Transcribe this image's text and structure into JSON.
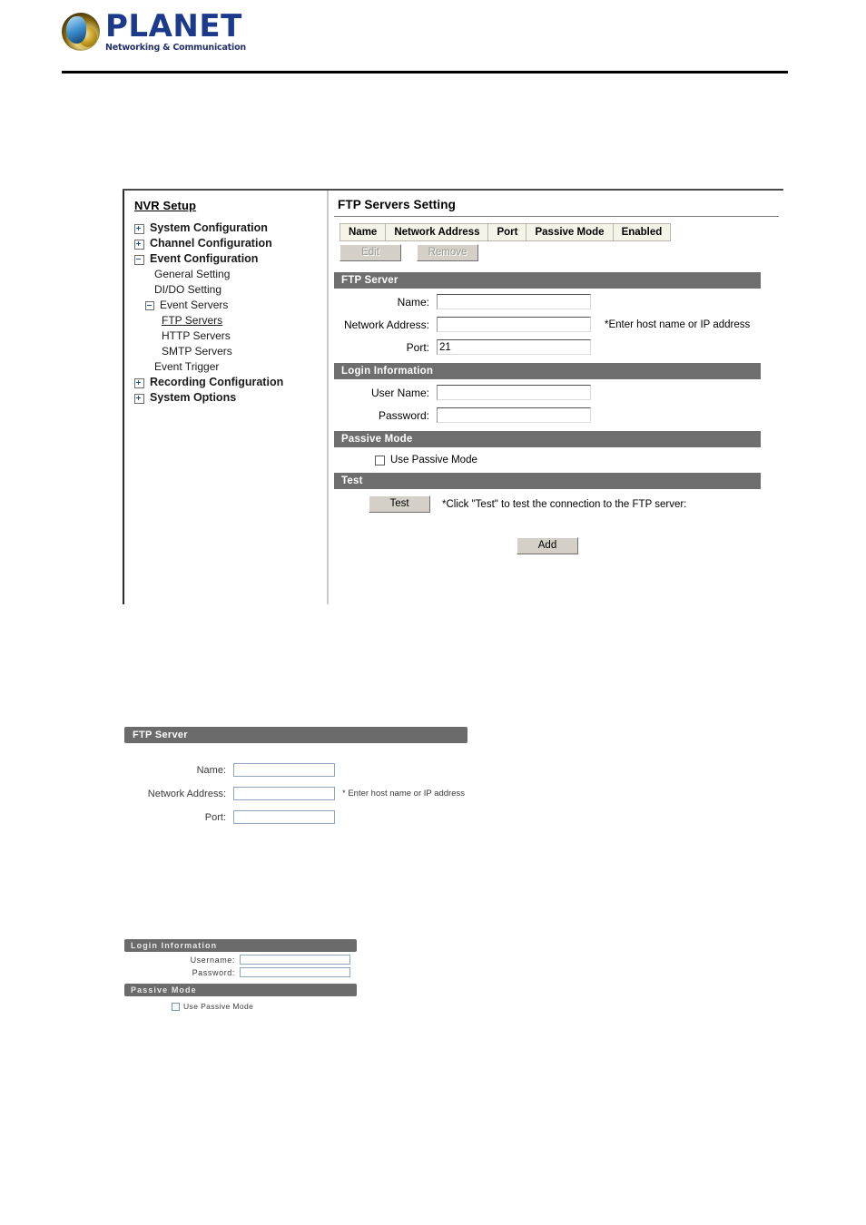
{
  "brand": {
    "name": "PLANET",
    "tagline": "Networking & Communication",
    "logo_icon": "planet-globe-icon",
    "brand_color": "#1b3a8c",
    "accent_gold": "#c9a227"
  },
  "sidebar": {
    "title": "NVR Setup",
    "items": [
      {
        "label": "System Configuration",
        "level": 0,
        "toggle": "plus",
        "current": false
      },
      {
        "label": "Channel Configuration",
        "level": 0,
        "toggle": "plus",
        "current": false
      },
      {
        "label": "Event Configuration",
        "level": 0,
        "toggle": "minus",
        "current": false
      },
      {
        "label": "General Setting",
        "level": 1,
        "toggle": "none",
        "current": false
      },
      {
        "label": "DI/DO Setting",
        "level": 1,
        "toggle": "none",
        "current": false
      },
      {
        "label": "Event Servers",
        "level": 1,
        "toggle": "minus",
        "current": false
      },
      {
        "label": "FTP Servers",
        "level": 2,
        "toggle": "none",
        "current": true
      },
      {
        "label": "HTTP Servers",
        "level": 2,
        "toggle": "none",
        "current": false
      },
      {
        "label": "SMTP Servers",
        "level": 2,
        "toggle": "none",
        "current": false
      },
      {
        "label": "Event Trigger",
        "level": 1,
        "toggle": "none",
        "current": false
      },
      {
        "label": "Recording Configuration",
        "level": 0,
        "toggle": "plus",
        "current": false
      },
      {
        "label": "System Options",
        "level": 0,
        "toggle": "plus",
        "current": false
      }
    ]
  },
  "content": {
    "title": "FTP Servers Setting",
    "table": {
      "columns": [
        "Name",
        "Network Address",
        "Port",
        "Passive Mode",
        "Enabled"
      ],
      "rows": []
    },
    "table_buttons": [
      {
        "label": "Edit",
        "disabled": true
      },
      {
        "label": "Remove",
        "disabled": true
      }
    ],
    "sections": {
      "ftp_server": {
        "header": "FTP Server",
        "fields": [
          {
            "label": "Name:",
            "value": "",
            "placeholder": "",
            "hint": ""
          },
          {
            "label": "Network Address:",
            "value": "",
            "placeholder": "",
            "hint": "*Enter host name or IP address"
          },
          {
            "label": "Port:",
            "value": "21",
            "placeholder": "",
            "hint": ""
          }
        ]
      },
      "login_information": {
        "header": "Login Information",
        "fields": [
          {
            "label": "User Name:",
            "value": "",
            "placeholder": ""
          },
          {
            "label": "Password:",
            "value": "",
            "placeholder": ""
          }
        ]
      },
      "passive_mode": {
        "header": "Passive Mode",
        "checkbox_label": "Use Passive Mode",
        "checked": false
      },
      "test": {
        "header": "Test",
        "button_label": "Test",
        "hint": "*Click \"Test\" to test the connection to the FTP server:"
      }
    },
    "submit_button": "Add"
  },
  "figure_ftp_server": {
    "header": "FTP Server",
    "fields": [
      {
        "label": "Name:",
        "value": "",
        "hint": ""
      },
      {
        "label": "Network Address:",
        "value": "",
        "hint": "* Enter host name or IP address"
      },
      {
        "label": "Port:",
        "value": "",
        "hint": ""
      }
    ]
  },
  "figure_login_passive": {
    "login_header": "Login Information",
    "login_fields": [
      {
        "label": "Username:",
        "value": ""
      },
      {
        "label": "Password:",
        "value": ""
      }
    ],
    "passive_header": "Passive Mode",
    "passive_checkbox_label": "Use Passive Mode",
    "passive_checked": false
  }
}
